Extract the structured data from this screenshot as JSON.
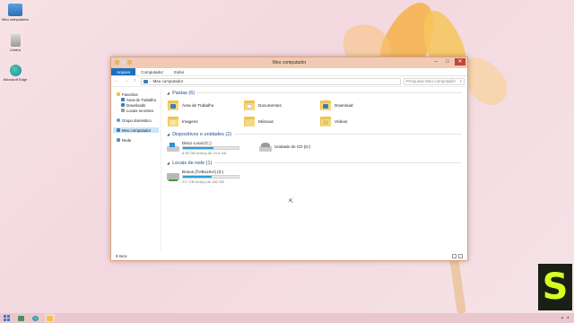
{
  "desktop": {
    "icons": [
      {
        "label": "Meu computador",
        "icon": "computer-icon"
      },
      {
        "label": "Lixeira",
        "icon": "recycle-bin-icon"
      },
      {
        "label": "Microsoft Edge",
        "icon": "edge-icon"
      }
    ]
  },
  "window": {
    "title": "Meu computador",
    "ribbon_tabs": [
      "Arquivo",
      "Computador",
      "Exibir"
    ],
    "active_tab": "Arquivo",
    "address": {
      "breadcrumb": "Meu computador",
      "separator": "›"
    },
    "search": {
      "placeholder": "Pesquisar Meu computador"
    },
    "nav_back": "←",
    "nav_forward": "→",
    "nav_up": "↑",
    "controls": {
      "minimize": "–",
      "maximize": "□",
      "close": "✕"
    }
  },
  "navpane": {
    "favorites": {
      "label": "Favoritos",
      "items": [
        "Área de Trabalho",
        "Downloads",
        "Locais recentes"
      ]
    },
    "homegroup": "Grupo doméstico",
    "computer": "Meu computador",
    "network": "Rede"
  },
  "folders_group": {
    "header": "Pastas (6)",
    "items": [
      {
        "name": "Área de Trabalho",
        "icon": "desktop-folder-icon",
        "badge_color": "#3b7dbf"
      },
      {
        "name": "Documentos",
        "icon": "documents-folder-icon",
        "badge_color": "#ffffff"
      },
      {
        "name": "Download",
        "icon": "download-folder-icon",
        "badge_color": "#3b7dbf"
      },
      {
        "name": "Imagens",
        "icon": "pictures-folder-icon",
        "badge_color": "#f5e6b8"
      },
      {
        "name": "Músicas",
        "icon": "music-folder-icon",
        "badge_color": "#e9d9a0"
      },
      {
        "name": "Vídeos",
        "icon": "videos-folder-icon",
        "badge_color": "#d9c58a"
      }
    ]
  },
  "devices_group": {
    "header": "Dispositivos e unidades (2)",
    "items": [
      {
        "name": "Disco Local (C:)",
        "free": "8,95 GB livre(s) de 19,8 GB",
        "used_fraction": 0.55,
        "icon": "local-disk-icon"
      },
      {
        "name": "Unidade de CD (D:)",
        "free": "",
        "used_fraction": null,
        "icon": "cd-drive-icon"
      }
    ]
  },
  "network_group": {
    "header": "Locais de rede (1)",
    "items": [
      {
        "name": "Bonus (\\\\VBoxSvr) (Z:)",
        "free": "217 GB livre(s) de 452 GB",
        "used_fraction": 0.52,
        "icon": "network-drive-icon"
      }
    ]
  },
  "status": {
    "items_count": "9 itens"
  },
  "colors": {
    "accent": "#1e6fc0",
    "bar_fill": "#26a0da",
    "titlebar": "#f2c9b3",
    "taskbar": "#e9c7cc"
  }
}
